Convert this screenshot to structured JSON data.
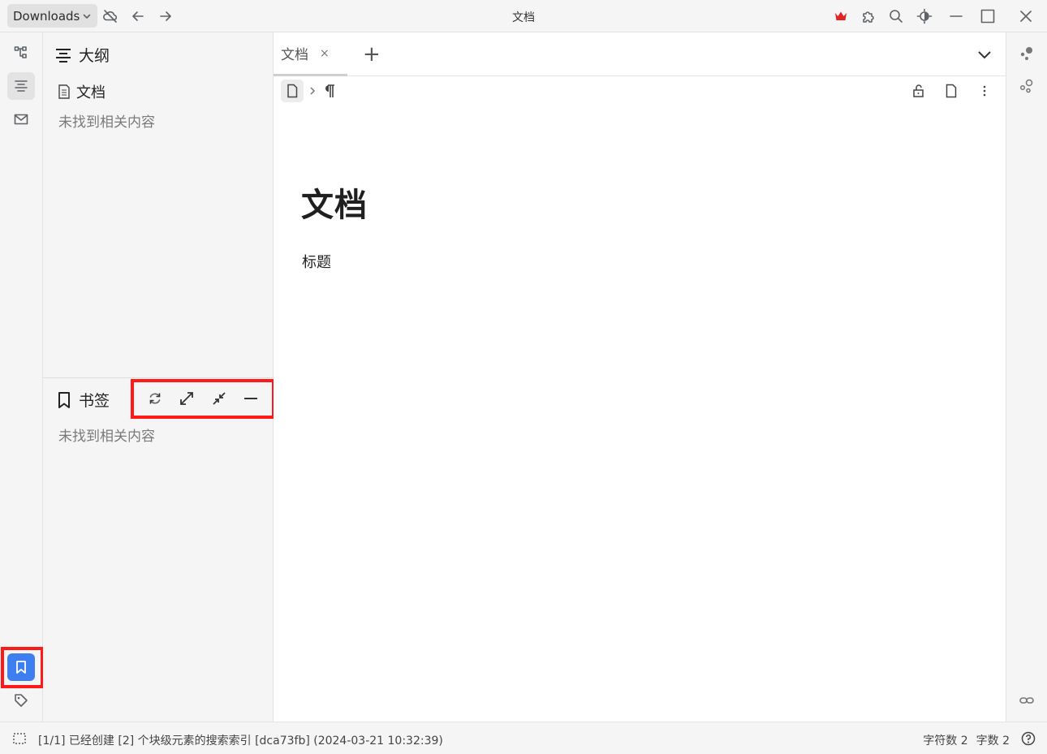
{
  "titlebar": {
    "workspace_label": "Downloads",
    "window_title": "文档",
    "accent_crown": "#e02424"
  },
  "outline": {
    "title": "大纲",
    "doc_label": "文档",
    "empty_text": "未找到相关内容"
  },
  "bookmarks": {
    "title": "书签",
    "empty_text": "未找到相关内容"
  },
  "editor": {
    "tab_label": "文档",
    "tab_close": "×",
    "add_tab": "+",
    "doc_title": "文档",
    "paragraph": "标题"
  },
  "status": {
    "message": "[1/1] 已经创建 [2] 个块级元素的搜索索引 [dca73fb] (2024-03-21 10:32:39)",
    "char_count": "字符数 2",
    "word_count": "字数 2"
  },
  "highlight_color": "#ff1a1a",
  "active_dock_color": "#3d7ff1"
}
